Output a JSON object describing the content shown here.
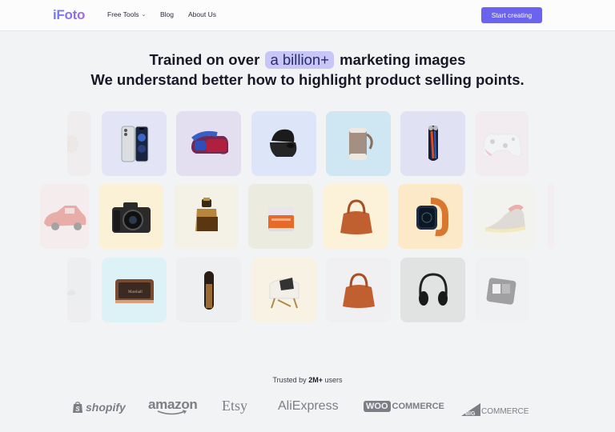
{
  "nav": {
    "logo": "iFoto",
    "links": [
      {
        "label": "Free Tools",
        "has_dropdown": true
      },
      {
        "label": "Blog"
      },
      {
        "label": "About Us"
      }
    ],
    "cta_label": "Start creating",
    "accent_color": "#6a63ee"
  },
  "hero": {
    "line1_prefix": "Trained on over",
    "line1_highlight": "a billion+",
    "line1_suffix": "marketing images",
    "line2": "We understand better how to highlight product selling points."
  },
  "gallery": {
    "rows": [
      {
        "items": [
          {
            "product": "watch-band (partial)",
            "icon": "round-object-icon",
            "bg": "#efe7e6",
            "faded": true
          },
          {
            "product": "smartphone",
            "icon": "smartphone-icon",
            "bg": "#e3e5f7"
          },
          {
            "product": "vr-headset",
            "icon": "vr-headset-icon",
            "bg": "#e4dff0"
          },
          {
            "product": "earbuds-case",
            "icon": "earbuds-icon",
            "bg": "#dde6f8"
          },
          {
            "product": "bluetooth-speaker",
            "icon": "speaker-icon",
            "bg": "#cfe6f3"
          },
          {
            "product": "electric-shaver",
            "icon": "shaver-icon",
            "bg": "#e0e1f2"
          },
          {
            "product": "game-controller",
            "icon": "controller-icon",
            "bg": "#f4e5ea",
            "faded": true
          }
        ]
      },
      {
        "items": [
          {
            "product": "toy-car",
            "icon": "car-icon",
            "bg": "#f7e4e5",
            "faded": true
          },
          {
            "product": "camera",
            "icon": "camera-icon",
            "bg": "#fbf1d7"
          },
          {
            "product": "perfume",
            "icon": "perfume-icon",
            "bg": "#f4f1e6"
          },
          {
            "product": "cream-jar",
            "icon": "jar-icon",
            "bg": "#ebecdf"
          },
          {
            "product": "handbag",
            "icon": "handbag-icon",
            "bg": "#fcf2da"
          },
          {
            "product": "smartwatch",
            "icon": "watch-icon",
            "bg": "#fce9c7"
          },
          {
            "product": "sneaker",
            "icon": "sneaker-icon",
            "bg": "#f3f1e9",
            "faded": true
          },
          {
            "product": "partial",
            "icon": "blank-icon",
            "bg": "#f6e9ec",
            "faded": true
          }
        ]
      },
      {
        "items": [
          {
            "product": "mouse (partial)",
            "icon": "mouse-icon",
            "bg": "#e8e9ec",
            "faded": true
          },
          {
            "product": "radio-speaker",
            "icon": "radio-icon",
            "bg": "#dcf2f6"
          },
          {
            "product": "hair-tool",
            "icon": "tube-icon",
            "bg": "#eeeff1"
          },
          {
            "product": "armchair",
            "icon": "chair-icon",
            "bg": "#f7f2e3"
          },
          {
            "product": "black-handbag",
            "icon": "handbag-icon",
            "bg": "#f0f0f2"
          },
          {
            "product": "headphones",
            "icon": "headphones-icon",
            "bg": "#e1e2e2"
          },
          {
            "product": "gadget",
            "icon": "device-icon",
            "bg": "#eeeff2",
            "faded": true
          }
        ]
      }
    ]
  },
  "trusted": {
    "prefix": "Trusted by",
    "count": "2M+",
    "suffix": "users"
  },
  "brands": [
    "shopify",
    "amazon",
    "Etsy",
    "AliExpress",
    "WOO",
    "COMMERCE",
    "BIG",
    "COMMERCE"
  ]
}
